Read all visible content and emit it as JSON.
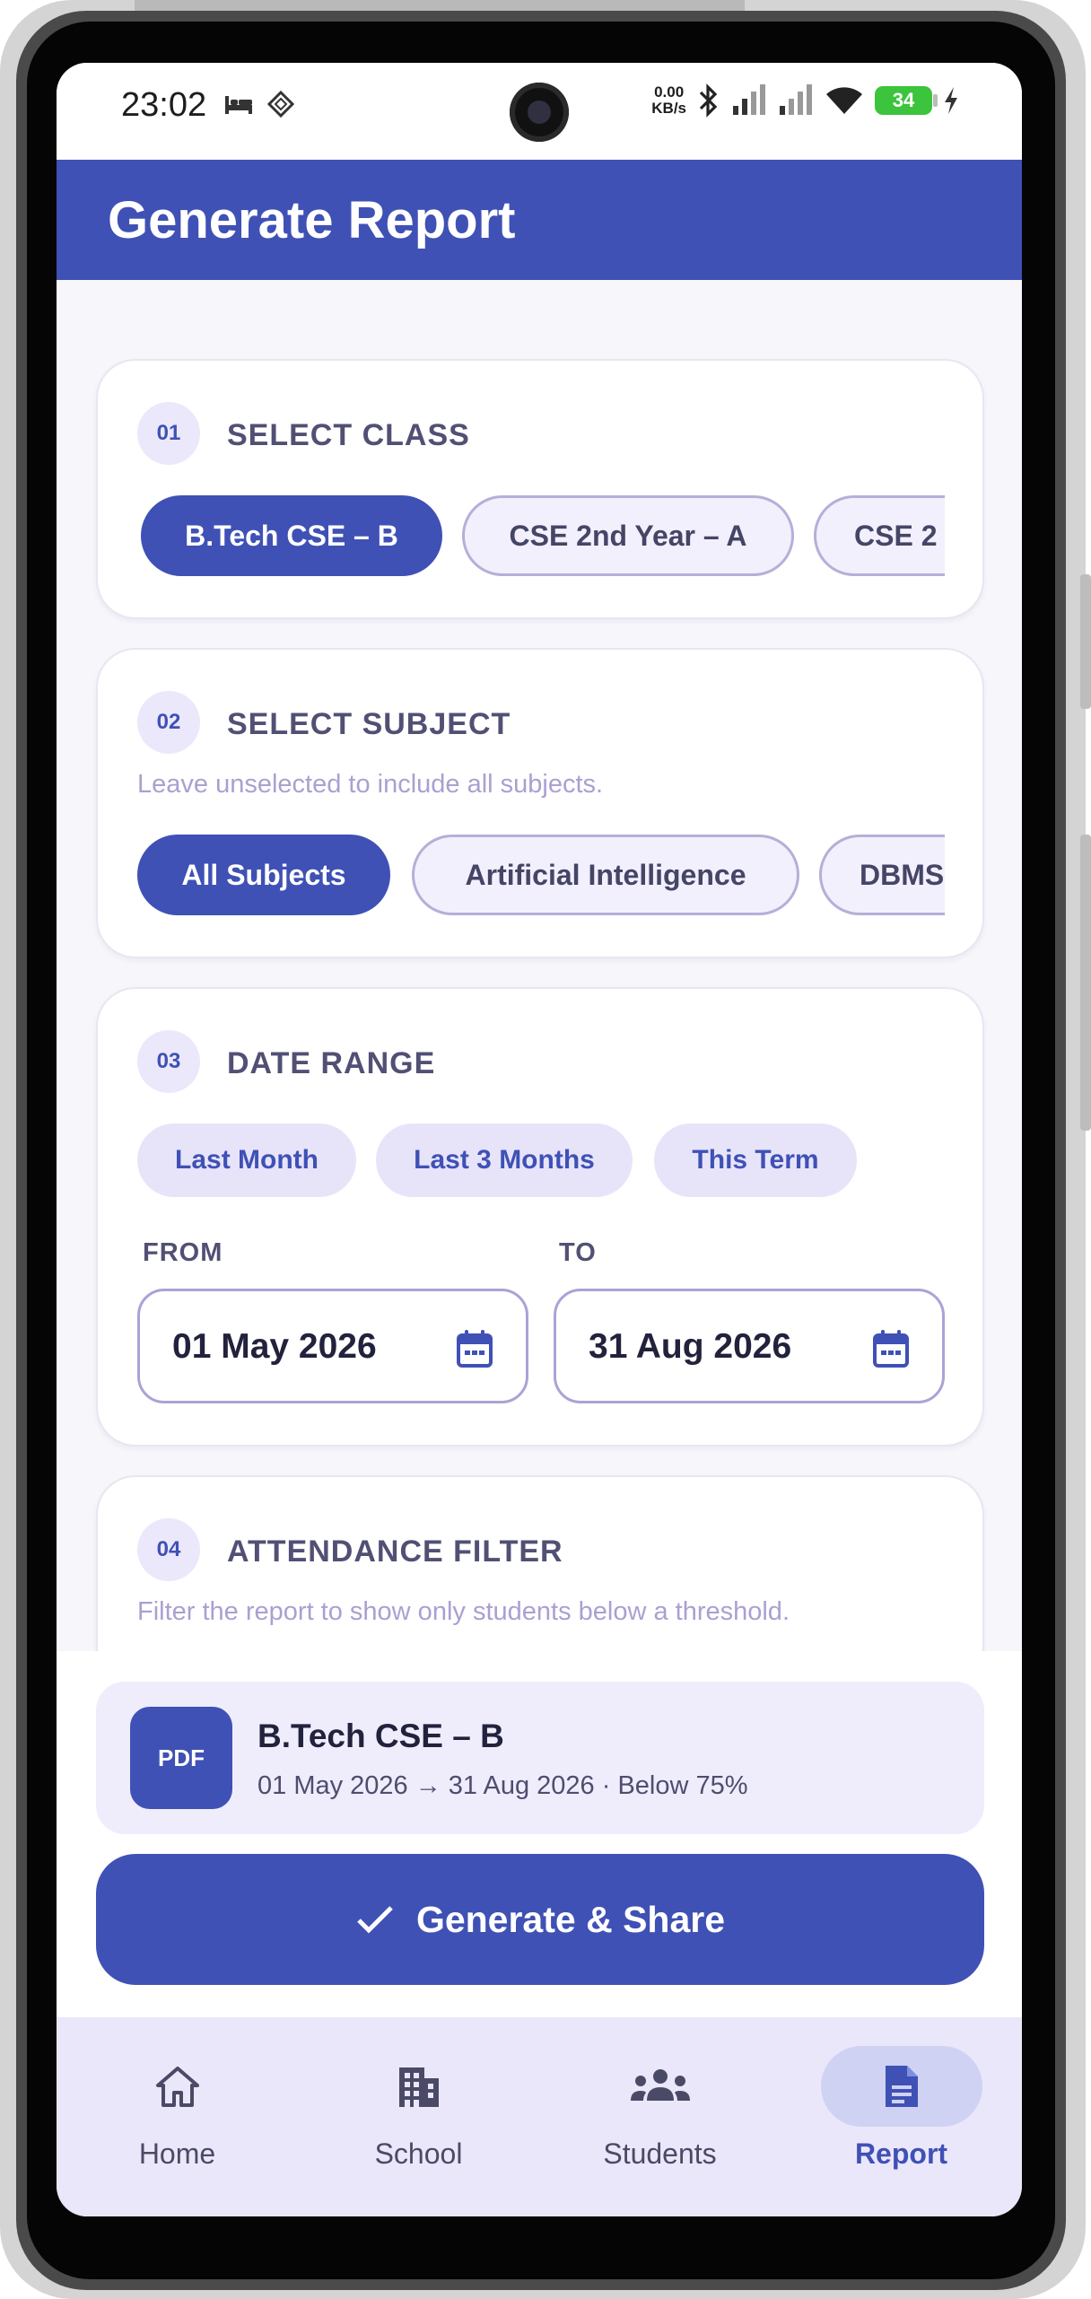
{
  "status_bar": {
    "time": "23:02",
    "net_speed_value": "0.00",
    "net_speed_unit": "KB/s",
    "battery_level": "34"
  },
  "app_bar": {
    "title": "Generate Report"
  },
  "sections": {
    "class": {
      "number": "01",
      "title": "SELECT CLASS",
      "chips": [
        "B.Tech CSE – B",
        "CSE 2nd Year – A",
        "CSE 2"
      ],
      "selected_index": 0
    },
    "subject": {
      "number": "02",
      "title": "SELECT SUBJECT",
      "hint": "Leave unselected to include all subjects.",
      "chips": [
        "All Subjects",
        "Artificial Intelligence",
        "DBMS"
      ],
      "selected_index": 0
    },
    "date_range": {
      "number": "03",
      "title": "DATE RANGE",
      "presets": [
        "Last Month",
        "Last 3 Months",
        "This Term"
      ],
      "from_label": "FROM",
      "to_label": "TO",
      "from_value": "01 May 2026",
      "to_value": "31 Aug 2026"
    },
    "attendance": {
      "number": "04",
      "title": "ATTENDANCE FILTER",
      "hint": "Filter the report to show only students below a threshold."
    }
  },
  "summary": {
    "badge": "PDF",
    "title": "B.Tech CSE – B",
    "subtitle": "01 May 2026 → 31 Aug 2026 · Below 75%"
  },
  "generate_button": {
    "label": "Generate & Share",
    "icon": "check-icon"
  },
  "bottom_nav": {
    "items": [
      {
        "label": "Home",
        "icon": "home-icon"
      },
      {
        "label": "School",
        "icon": "building-icon"
      },
      {
        "label": "Students",
        "icon": "group-icon"
      },
      {
        "label": "Report",
        "icon": "document-icon"
      }
    ],
    "active_index": 3
  },
  "colors": {
    "primary": "#3f51b5",
    "chip_bg": "#f2f0fc",
    "pill_bg": "#e7e4fa",
    "nav_bg": "#ebe7fb",
    "battery": "#3cc43c"
  }
}
